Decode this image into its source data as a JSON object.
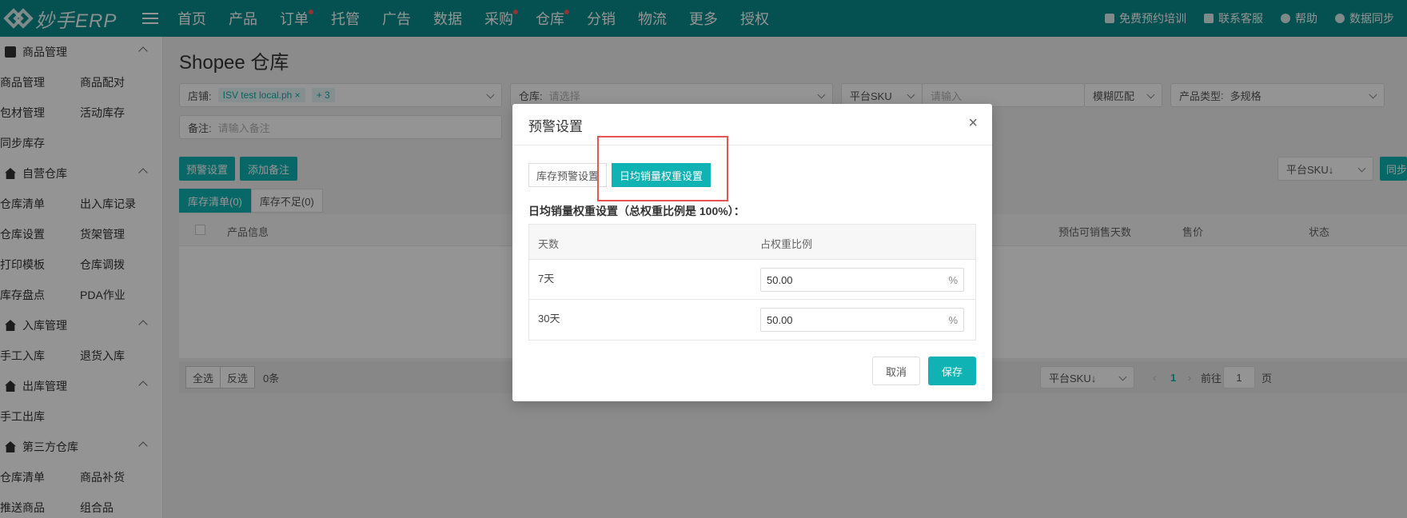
{
  "app": {
    "logo_text": "妙手ERP"
  },
  "nav": {
    "items": [
      {
        "label": "首页",
        "dot": false
      },
      {
        "label": "产品",
        "dot": false
      },
      {
        "label": "订单",
        "dot": true
      },
      {
        "label": "托管",
        "dot": false
      },
      {
        "label": "广告",
        "dot": false
      },
      {
        "label": "数据",
        "dot": false
      },
      {
        "label": "采购",
        "dot": true
      },
      {
        "label": "仓库",
        "dot": true
      },
      {
        "label": "分销",
        "dot": false
      },
      {
        "label": "物流",
        "dot": false
      },
      {
        "label": "更多",
        "dot": false
      },
      {
        "label": "授权",
        "dot": false
      }
    ],
    "right": [
      "免费预约培训",
      "联系客服",
      "帮助",
      "数据同步"
    ]
  },
  "sidebar": {
    "groups": [
      {
        "title": "商品管理",
        "rows": [
          [
            "商品管理",
            "商品配对"
          ],
          [
            "包材管理",
            "活动库存"
          ],
          [
            "同步库存"
          ]
        ]
      },
      {
        "title": "自营仓库",
        "rows": [
          [
            "仓库清单",
            "出入库记录"
          ],
          [
            "仓库设置",
            "货架管理"
          ],
          [
            "打印模板",
            "仓库调拨"
          ],
          [
            "库存盘点",
            "PDA作业"
          ]
        ]
      },
      {
        "title": "入库管理",
        "rows": [
          [
            "手工入库",
            "退货入库"
          ]
        ]
      },
      {
        "title": "出库管理",
        "rows": [
          [
            "手工出库"
          ]
        ]
      },
      {
        "title": "第三方仓库",
        "rows": [
          [
            "仓库清单",
            "商品补货"
          ],
          [
            "推送商品",
            "组合品"
          ]
        ]
      }
    ]
  },
  "page": {
    "title": "Shopee 仓库",
    "filters": {
      "store_label": "店铺:",
      "store_tag": "ISV test local.ph",
      "store_more": "+ 3",
      "warehouse_label": "仓库:",
      "warehouse_placeholder": "请选择",
      "sku_select": "平台SKU",
      "sku_placeholder": "请输入",
      "match_select": "模糊匹配",
      "product_type_label": "产品类型",
      "product_type_value": "多规格",
      "remark_label": "备注:",
      "remark_placeholder": "请输入备注"
    },
    "buttons": {
      "warning": "预警设置",
      "add_remark": "添加备注",
      "sort": "平台SKU↓",
      "sync": "同步"
    },
    "tabs": [
      "库存清单(0)",
      "库存不足(0)"
    ],
    "columns": [
      "产品信息",
      "预估可销售天数",
      "售价",
      "状态"
    ],
    "footer": {
      "select_all": "全选",
      "invert": "反选",
      "count": "0条",
      "sort": "平台SKU↓",
      "page": "1",
      "goto_label": "前往",
      "goto_value": "1",
      "page_suffix": "页"
    }
  },
  "modal": {
    "title": "预警设置",
    "close": "×",
    "tabs": [
      "库存预警设置",
      "日均销量权重设置"
    ],
    "section_label": "日均销量权重设置（总权重比例是 100%）：",
    "columns": [
      "天数",
      "占权重比例"
    ],
    "rows": [
      {
        "day": "7天",
        "value": "50.00",
        "unit": "%"
      },
      {
        "day": "30天",
        "value": "50.00",
        "unit": "%"
      }
    ],
    "cancel": "取消",
    "save": "保存"
  },
  "colors": {
    "brand": "#0a8b8b",
    "accent": "#0fb3b3",
    "highlight": "#e85555"
  }
}
